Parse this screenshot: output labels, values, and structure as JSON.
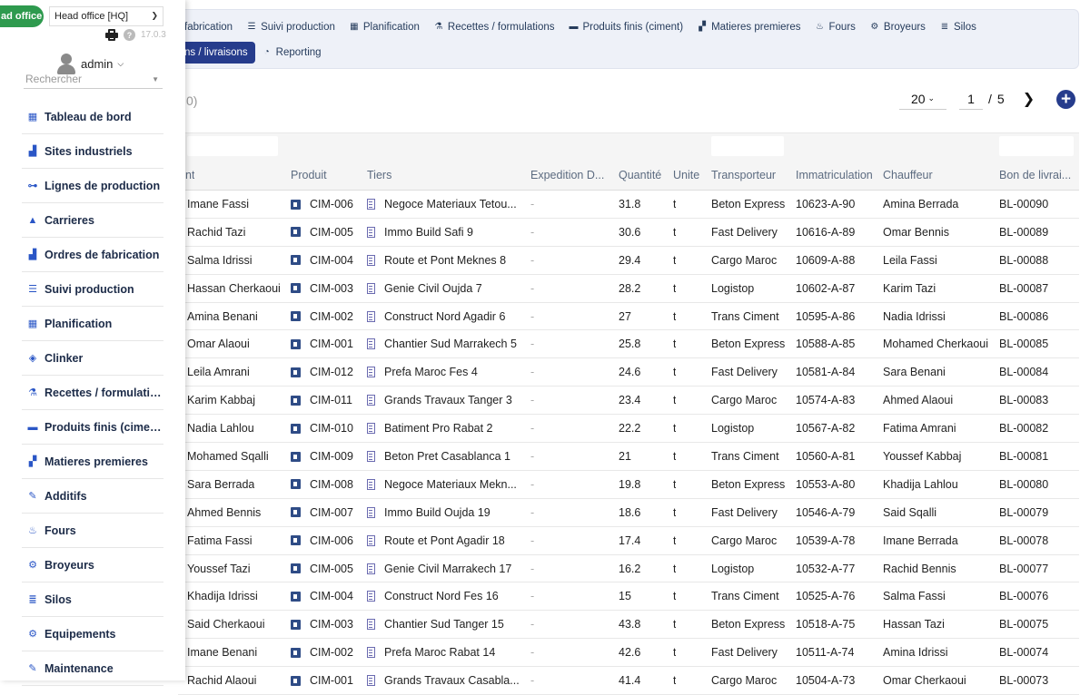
{
  "entity": {
    "button": "ad office",
    "selected": "Head office [HQ]"
  },
  "tools": {
    "version": "17.0.3"
  },
  "user": {
    "name": "admin"
  },
  "sidebar_search": {
    "placeholder": "Rechercher"
  },
  "nav": [
    {
      "label": "Tableau de bord",
      "icon": "dashboard-icon",
      "glyph": "▦"
    },
    {
      "label": "Sites industriels",
      "icon": "factory-icon",
      "glyph": "▟"
    },
    {
      "label": "Lignes de production",
      "icon": "hierarchy-icon",
      "glyph": "⊶"
    },
    {
      "label": "Carrieres",
      "icon": "mountain-icon",
      "glyph": "▲"
    },
    {
      "label": "Ordres de fabrication",
      "icon": "factory-icon",
      "glyph": "▟"
    },
    {
      "label": "Suivi production",
      "icon": "list-icon",
      "glyph": "☰"
    },
    {
      "label": "Planification",
      "icon": "calendar-icon",
      "glyph": "▦"
    },
    {
      "label": "Clinker",
      "icon": "cube-icon",
      "glyph": "◈"
    },
    {
      "label": "Recettes / formulations",
      "icon": "flask-icon",
      "glyph": "⚗"
    },
    {
      "label": "Produits finis (ciment)",
      "icon": "box-icon",
      "glyph": "▬"
    },
    {
      "label": "Matieres premieres",
      "icon": "cubes-icon",
      "glyph": "▞"
    },
    {
      "label": "Additifs",
      "icon": "eyedropper-icon",
      "glyph": "✎"
    },
    {
      "label": "Fours",
      "icon": "fire-icon",
      "glyph": "♨"
    },
    {
      "label": "Broyeurs",
      "icon": "cogs-icon",
      "glyph": "⚙"
    },
    {
      "label": "Silos",
      "icon": "database-icon",
      "glyph": "≣"
    },
    {
      "label": "Equipements",
      "icon": "gear-icon",
      "glyph": "⚙"
    },
    {
      "label": "Maintenance",
      "icon": "wrench-icon",
      "glyph": "✎"
    }
  ],
  "top_menu": {
    "row1": [
      {
        "label": "fabrication",
        "icon": ""
      },
      {
        "label": "Suivi production",
        "icon": "☰"
      },
      {
        "label": "Planification",
        "icon": "▦"
      },
      {
        "label": "Recettes / formulations",
        "icon": "⚗"
      },
      {
        "label": "Produits finis (ciment)",
        "icon": "▬"
      },
      {
        "label": "Matieres premieres",
        "icon": "▞"
      },
      {
        "label": "Fours",
        "icon": "♨"
      },
      {
        "label": "Broyeurs",
        "icon": "⚙"
      },
      {
        "label": "Silos",
        "icon": "≣"
      }
    ],
    "row2": [
      {
        "label": "ns / livraisons",
        "icon": "",
        "active": true
      },
      {
        "label": "Reporting",
        "icon": "◔",
        "active": false
      }
    ]
  },
  "list": {
    "count_text": "0)"
  },
  "pager": {
    "limit": "20",
    "page": "1",
    "sep": "/",
    "total": "5"
  },
  "columns": [
    "nt",
    "Produit",
    "Tiers",
    "Expedition D...",
    "Quantité",
    "Unite",
    "Transporteur",
    "Immatriculation",
    "Chauffeur",
    "Bon de livrai..."
  ],
  "rows": [
    {
      "client": "Imane Fassi",
      "produit": "CIM-006",
      "tiers": "Negoce Materiaux Tetou...",
      "exp": "-",
      "qty": "31.8",
      "unit": "t",
      "transporteur": "Beton Express",
      "immat": "10623-A-90",
      "chauffeur": "Amina Berrada",
      "bon": "BL-00090"
    },
    {
      "client": "Rachid Tazi",
      "produit": "CIM-005",
      "tiers": "Immo Build Safi 9",
      "exp": "-",
      "qty": "30.6",
      "unit": "t",
      "transporteur": "Fast Delivery",
      "immat": "10616-A-89",
      "chauffeur": "Omar Bennis",
      "bon": "BL-00089"
    },
    {
      "client": "Salma Idrissi",
      "produit": "CIM-004",
      "tiers": "Route et Pont Meknes 8",
      "exp": "-",
      "qty": "29.4",
      "unit": "t",
      "transporteur": "Cargo Maroc",
      "immat": "10609-A-88",
      "chauffeur": "Leila Fassi",
      "bon": "BL-00088"
    },
    {
      "client": "Hassan Cherkaoui",
      "produit": "CIM-003",
      "tiers": "Genie Civil Oujda 7",
      "exp": "-",
      "qty": "28.2",
      "unit": "t",
      "transporteur": "Logistop",
      "immat": "10602-A-87",
      "chauffeur": "Karim Tazi",
      "bon": "BL-00087"
    },
    {
      "client": "Amina Benani",
      "produit": "CIM-002",
      "tiers": "Construct Nord Agadir 6",
      "exp": "-",
      "qty": "27",
      "unit": "t",
      "transporteur": "Trans Ciment",
      "immat": "10595-A-86",
      "chauffeur": "Nadia Idrissi",
      "bon": "BL-00086"
    },
    {
      "client": "Omar Alaoui",
      "produit": "CIM-001",
      "tiers": "Chantier Sud Marrakech 5",
      "exp": "-",
      "qty": "25.8",
      "unit": "t",
      "transporteur": "Beton Express",
      "immat": "10588-A-85",
      "chauffeur": "Mohamed Cherkaoui",
      "bon": "BL-00085"
    },
    {
      "client": "Leila Amrani",
      "produit": "CIM-012",
      "tiers": "Prefa Maroc Fes 4",
      "exp": "-",
      "qty": "24.6",
      "unit": "t",
      "transporteur": "Fast Delivery",
      "immat": "10581-A-84",
      "chauffeur": "Sara Benani",
      "bon": "BL-00084"
    },
    {
      "client": "Karim Kabbaj",
      "produit": "CIM-011",
      "tiers": "Grands Travaux Tanger 3",
      "exp": "-",
      "qty": "23.4",
      "unit": "t",
      "transporteur": "Cargo Maroc",
      "immat": "10574-A-83",
      "chauffeur": "Ahmed Alaoui",
      "bon": "BL-00083"
    },
    {
      "client": "Nadia Lahlou",
      "produit": "CIM-010",
      "tiers": "Batiment Pro Rabat 2",
      "exp": "-",
      "qty": "22.2",
      "unit": "t",
      "transporteur": "Logistop",
      "immat": "10567-A-82",
      "chauffeur": "Fatima Amrani",
      "bon": "BL-00082"
    },
    {
      "client": "Mohamed Sqalli",
      "produit": "CIM-009",
      "tiers": "Beton Pret Casablanca 1",
      "exp": "-",
      "qty": "21",
      "unit": "t",
      "transporteur": "Trans Ciment",
      "immat": "10560-A-81",
      "chauffeur": "Youssef Kabbaj",
      "bon": "BL-00081"
    },
    {
      "client": "Sara Berrada",
      "produit": "CIM-008",
      "tiers": "Negoce Materiaux Mekn...",
      "exp": "-",
      "qty": "19.8",
      "unit": "t",
      "transporteur": "Beton Express",
      "immat": "10553-A-80",
      "chauffeur": "Khadija Lahlou",
      "bon": "BL-00080"
    },
    {
      "client": "Ahmed Bennis",
      "produit": "CIM-007",
      "tiers": "Immo Build Oujda 19",
      "exp": "-",
      "qty": "18.6",
      "unit": "t",
      "transporteur": "Fast Delivery",
      "immat": "10546-A-79",
      "chauffeur": "Said Sqalli",
      "bon": "BL-00079"
    },
    {
      "client": "Fatima Fassi",
      "produit": "CIM-006",
      "tiers": "Route et Pont Agadir 18",
      "exp": "-",
      "qty": "17.4",
      "unit": "t",
      "transporteur": "Cargo Maroc",
      "immat": "10539-A-78",
      "chauffeur": "Imane Berrada",
      "bon": "BL-00078"
    },
    {
      "client": "Youssef Tazi",
      "produit": "CIM-005",
      "tiers": "Genie Civil Marrakech 17",
      "exp": "-",
      "qty": "16.2",
      "unit": "t",
      "transporteur": "Logistop",
      "immat": "10532-A-77",
      "chauffeur": "Rachid Bennis",
      "bon": "BL-00077"
    },
    {
      "client": "Khadija Idrissi",
      "produit": "CIM-004",
      "tiers": "Construct Nord Fes 16",
      "exp": "-",
      "qty": "15",
      "unit": "t",
      "transporteur": "Trans Ciment",
      "immat": "10525-A-76",
      "chauffeur": "Salma Fassi",
      "bon": "BL-00076"
    },
    {
      "client": "Said Cherkaoui",
      "produit": "CIM-003",
      "tiers": "Chantier Sud Tanger 15",
      "exp": "-",
      "qty": "43.8",
      "unit": "t",
      "transporteur": "Beton Express",
      "immat": "10518-A-75",
      "chauffeur": "Hassan Tazi",
      "bon": "BL-00075"
    },
    {
      "client": "Imane Benani",
      "produit": "CIM-002",
      "tiers": "Prefa Maroc Rabat 14",
      "exp": "-",
      "qty": "42.6",
      "unit": "t",
      "transporteur": "Fast Delivery",
      "immat": "10511-A-74",
      "chauffeur": "Amina Idrissi",
      "bon": "BL-00074"
    },
    {
      "client": "Rachid Alaoui",
      "produit": "CIM-001",
      "tiers": "Grands Travaux Casabla...",
      "exp": "-",
      "qty": "41.4",
      "unit": "t",
      "transporteur": "Cargo Maroc",
      "immat": "10504-A-73",
      "chauffeur": "Omar Cherkaoui",
      "bon": "BL-00073"
    }
  ],
  "colors": {
    "accent": "#263c8c",
    "entity_green": "#2e9a4e",
    "nav_icon": "#2a56c6"
  }
}
